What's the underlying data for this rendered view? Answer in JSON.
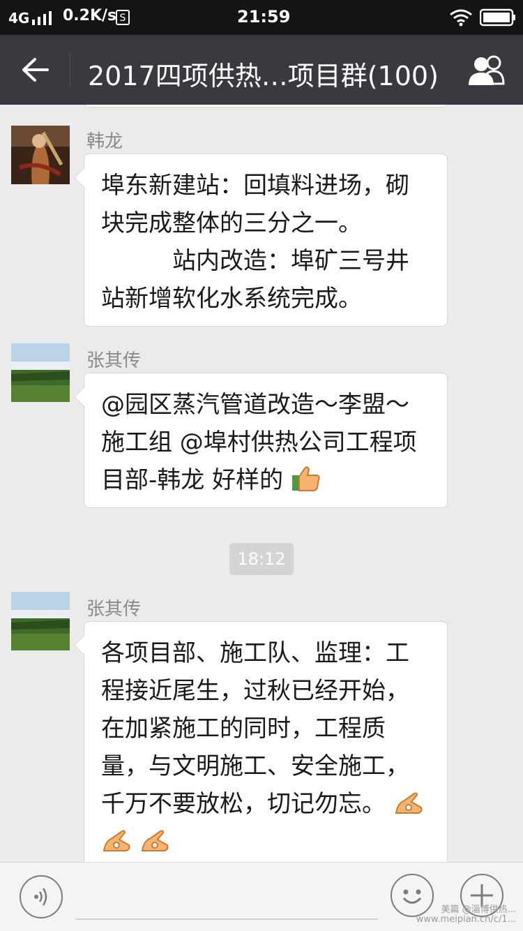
{
  "status_bar": {
    "network": "4G",
    "speed": "0.2K/s",
    "time": "21:59"
  },
  "header": {
    "title": "2017四项供热…项目群(100)",
    "back_icon": "arrow-left-icon",
    "members_icon": "group-members-icon"
  },
  "messages": [
    {
      "sender": "韩龙",
      "lines": [
        "埠东新建站：回填料进场，砌",
        "块完成整体的三分之一。",
        "　　　站内改造：埠矿三号井",
        "站新增软化水系统完成。"
      ]
    },
    {
      "sender": "张其传",
      "lines": [
        "@园区蒸汽管道改造～李盟～",
        "施工组 @埠村供热公司工程项",
        "目部-韩龙 好样的"
      ],
      "emoji": "thumbs-up-icon"
    },
    {
      "sender": "张其传",
      "lines": [
        "各项目部、施工队、监理：工",
        "程接近尾生，过秋已经开始，",
        "在加紧施工的同时，工程质",
        "量，与文明施工、安全施工，",
        "千万不要放松，切记勿忘。"
      ],
      "emoji": "ok-hand-icon"
    }
  ],
  "timestamp": "18:12",
  "input_bar": {
    "voice_icon": "voice-icon",
    "emoji_icon": "smiley-icon",
    "plus_icon": "plus-icon"
  },
  "watermark": {
    "line1": "美篇 @淄博供热...",
    "line2": "www.meipian.cn/c/1..."
  }
}
